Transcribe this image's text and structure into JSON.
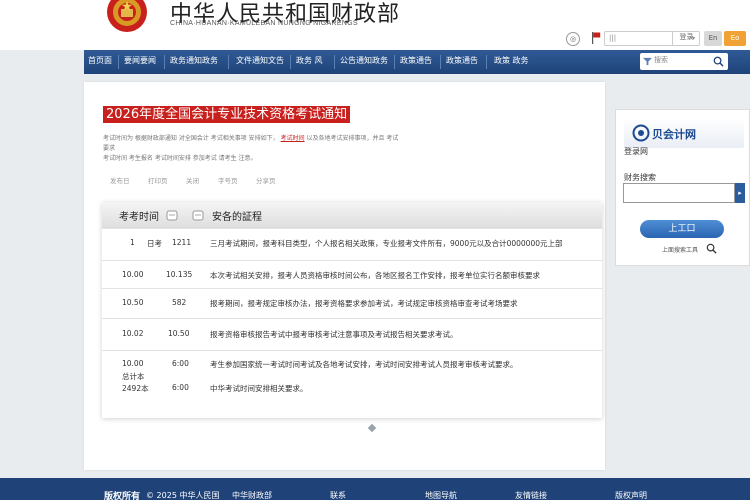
{
  "header": {
    "site_title": "中华人民共和国财政部",
    "site_subtitle": "CHINA·HUANAN·KAMULEBAN NUNGNG NIGARENGS",
    "tools": {
      "circle": "◎",
      "box_text": "|||",
      "login": "登录",
      "lang": "En",
      "orange": "Eo"
    }
  },
  "nav": {
    "items": [
      "首页面",
      "要闻要闻",
      "政务通知政务",
      "文件通知文告",
      "政务 风",
      "公告通知政务",
      "政策通告",
      "政策通告",
      "政策 政务"
    ],
    "search_placeholder": "搜索"
  },
  "article": {
    "title": "2026年度全国会计专业技术资格考试通知",
    "intro_line1": "考试时间为 根据财政部通知 对全国会计 考试相关事项 安排如下，",
    "intro_highlight": "考试时间",
    "intro_line1_tail": "以及各地考试安排事项，并且 考试要求",
    "intro_line2": "考试时间 考生报名 考试时间安排 参加考试 请考生 注意。",
    "meta": [
      "发布日",
      "打印页",
      "关闭",
      "字号页",
      "分享页"
    ]
  },
  "table": {
    "col1": "考考时间",
    "col2": "安各的証程",
    "rows": [
      {
        "c1": "1",
        "c2": "日考",
        "c3": "1211",
        "desc": "三月考试期间，报考科目类型，个人报名相关政策，专业报考文件所有，9000元以及合计0000000元上部"
      },
      {
        "c1": "10.00",
        "c2": "",
        "c3": "10.135",
        "desc": "本次考试相关安排，报考人员资格审核时间公布，各地区报名工作安排，报考单位实行名额审核要求"
      },
      {
        "c1": "10.50",
        "c2": "",
        "c3": "582",
        "desc": "报考期间，报考规定审核办法，报考资格要求参加考试，考试规定审核资格审查考试考场要求"
      },
      {
        "c1": "10.02",
        "c2": "",
        "c3": "10.50",
        "desc": "报考资格审核报告考试中报考审核考试注意事项及考试报告相关要求考试。"
      },
      {
        "c1": "10.00",
        "c2": "",
        "c3": "6:00",
        "desc": "考生参加国家统一考试时间考试及各地考试安排，考试时间安排考试人员报考审核考试要求。"
      },
      {
        "c1": "总计本",
        "c2": "",
        "c3": "",
        "desc": ""
      },
      {
        "c1": "2492本",
        "c2": "",
        "c3": "6:00",
        "desc": "中华考试时间安排相关要求。"
      }
    ]
  },
  "sidebar": {
    "logo_text": "贝会计网",
    "label_login": "登录网",
    "label_search": "财务搜索",
    "go": "▸",
    "button": "上工口",
    "link": "上面搜索工具"
  },
  "footer": {
    "left": "版权所有",
    "copyright": "© 2025 中华人民国",
    "org": "中华财政部",
    "items": [
      "联系",
      "地图导航",
      "友情链接",
      "版权声明"
    ]
  }
}
